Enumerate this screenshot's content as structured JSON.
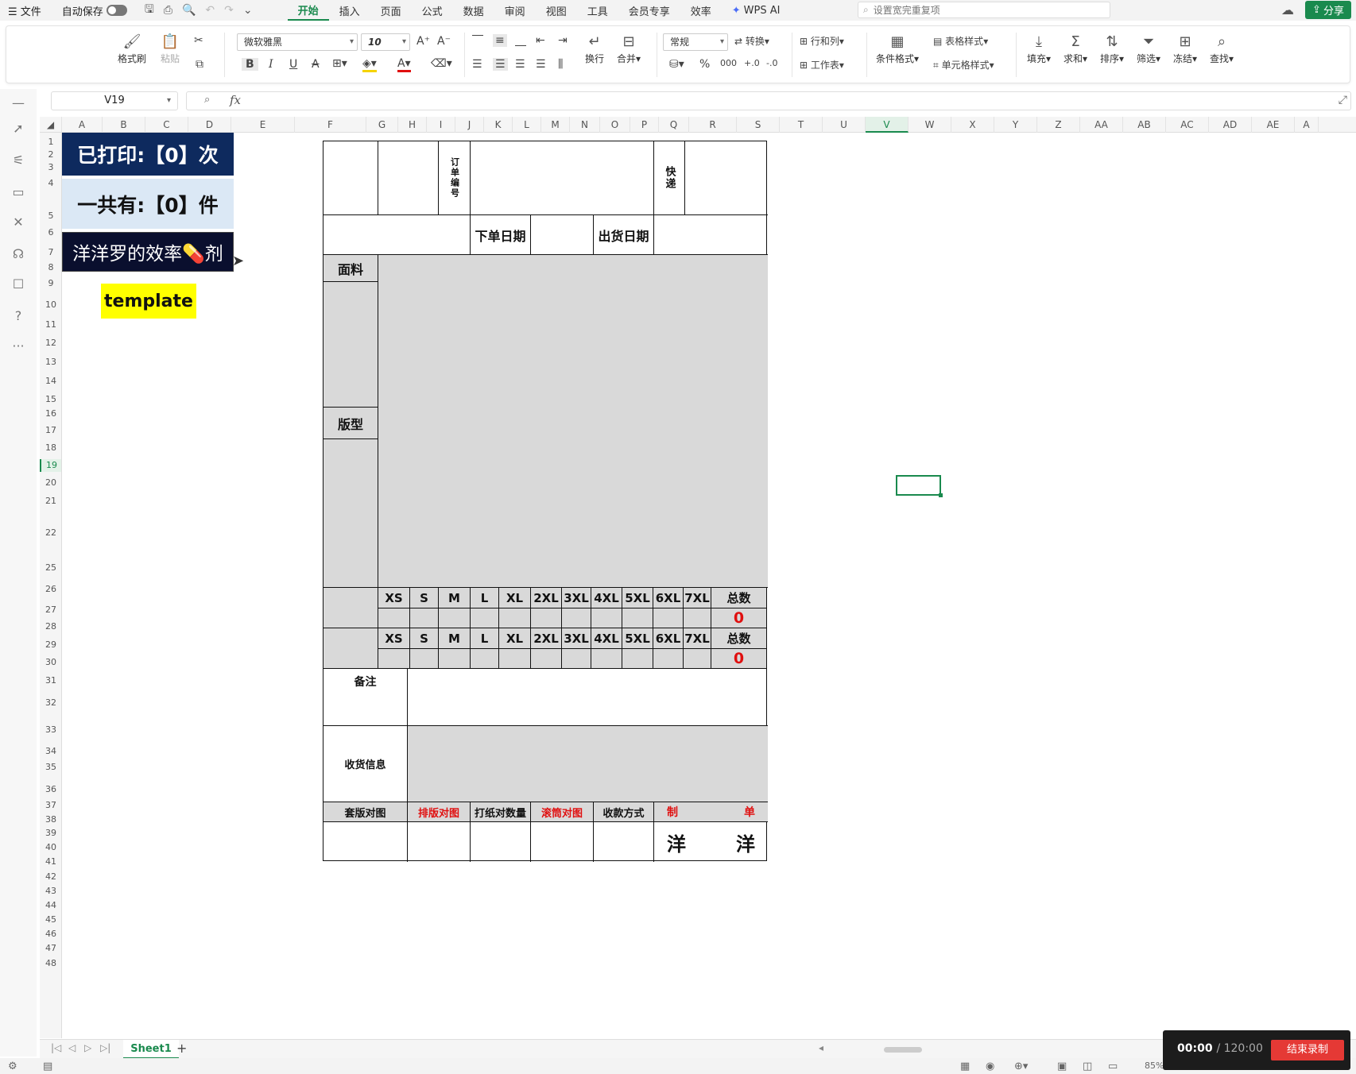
{
  "menubar": {
    "file_label": "☰ 文件",
    "autosave_label": "自动保存",
    "tabs": [
      "开始",
      "插入",
      "页面",
      "公式",
      "数据",
      "审阅",
      "视图",
      "工具",
      "会员专享",
      "效率"
    ],
    "active_tab": "开始",
    "wps_ai_label": "WPS AI",
    "search_placeholder": "设置宽完重复项",
    "share_label": "分享"
  },
  "ribbon": {
    "format_painter": "格式刷",
    "paste": "粘贴",
    "font_name": "微软雅黑",
    "font_size": "10",
    "bold": "B",
    "italic": "I",
    "underline": "U",
    "strike": "A",
    "wrap_text": "换行",
    "merge": "合并",
    "number_format": "常规",
    "convert": "转换",
    "percent": "%",
    "rows_cols": "行和列",
    "worksheet": "工作表",
    "cond_format": "条件格式",
    "table_style": "表格样式",
    "cell_style": "单元格样式",
    "fill": "填充",
    "sum": "求和",
    "sort": "排序",
    "filter": "筛选",
    "freeze": "冻结",
    "find": "查找"
  },
  "formula_bar": {
    "cell_ref": "V19",
    "fx_label": "fx",
    "formula": ""
  },
  "columns": [
    "A",
    "B",
    "C",
    "D",
    "E",
    "F",
    "G",
    "H",
    "I",
    "J",
    "K",
    "L",
    "M",
    "N",
    "O",
    "P",
    "Q",
    "R",
    "S",
    "T",
    "U",
    "V",
    "W",
    "X",
    "Y",
    "Z",
    "AA",
    "AB",
    "AC",
    "AD",
    "AE",
    "A"
  ],
  "rows": [
    "1",
    "2",
    "3",
    "4",
    "5",
    "6",
    "7",
    "8",
    "9",
    "10",
    "11",
    "12",
    "13",
    "14",
    "15",
    "16",
    "17",
    "18",
    "19",
    "20",
    "21",
    "22",
    "25",
    "26",
    "27",
    "28",
    "29",
    "30",
    "31",
    "32",
    "33",
    "34",
    "35",
    "36",
    "37",
    "38",
    "39",
    "40",
    "41",
    "42",
    "43",
    "44",
    "45",
    "46",
    "47",
    "48"
  ],
  "selected_column": "V",
  "selected_row": "19",
  "info": {
    "printed": "已打印:【0】次",
    "count": "一共有:【0】件",
    "efficiency": "洋洋罗的效率💊剂",
    "template": "template"
  },
  "sheet": {
    "order_no": "订单编号",
    "express": "快递",
    "order_date": "下单日期",
    "ship_date": "出货日期",
    "fabric": "面料",
    "pattern": "版型",
    "sizes": [
      "XS",
      "S",
      "M",
      "L",
      "XL",
      "2XL",
      "3XL",
      "4XL",
      "5XL",
      "6XL",
      "7XL"
    ],
    "total_label": "总数",
    "total1": "0",
    "total2": "0",
    "remark": "备注",
    "receiving": "收货信息",
    "footer_labels": [
      "套版对图",
      "排版对图",
      "打纸对数量",
      "滚筒对图",
      "收款方式"
    ],
    "made_by_1": "制",
    "made_by_2": "单",
    "sign_1": "洋",
    "sign_2": "洋"
  },
  "tabs": {
    "sheet1": "Sheet1",
    "add": "+"
  },
  "status": {
    "zoom": "85%"
  },
  "recorder": {
    "elapsed": "00:00",
    "total": "/ 120:00",
    "stop_label": "结束录制"
  }
}
